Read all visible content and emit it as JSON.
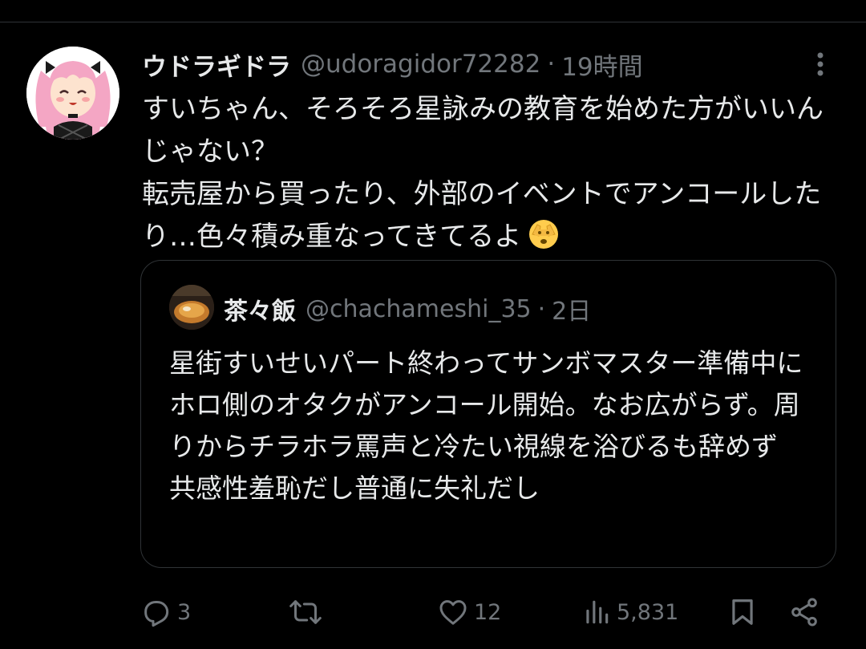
{
  "tweet": {
    "author_name": "ウドラギドラ",
    "handle": "@udoragidor72282",
    "separator": "·",
    "time": "19時間",
    "text": "すいちゃん、そろそろ星詠みの教育を始めた方がいいんじゃない？\n転売屋から買ったり、外部のイベントでアンコールしたり…色々積み重なってきてるよ",
    "emoji": "face-with-peeking-eye-icon"
  },
  "quote": {
    "author_name": "茶々飯",
    "handle": "@chachameshi_35",
    "separator": "·",
    "time": "2日",
    "text": "星街すいせいパート終わってサンボマスター準備中にホロ側のオタクがアンコール開始。なお広がらず。周りからチラホラ罵声と冷たい視線を浴びるも辞めず\n共感性羞恥だし普通に失礼だし"
  },
  "actions": {
    "replies": "3",
    "reposts": "",
    "likes": "12",
    "views": "5,831"
  },
  "colors": {
    "background": "#000000",
    "text": "#e7e9ea",
    "muted": "#71767b",
    "border": "#2f3336",
    "avatar_hair": "#f4a6c4"
  }
}
